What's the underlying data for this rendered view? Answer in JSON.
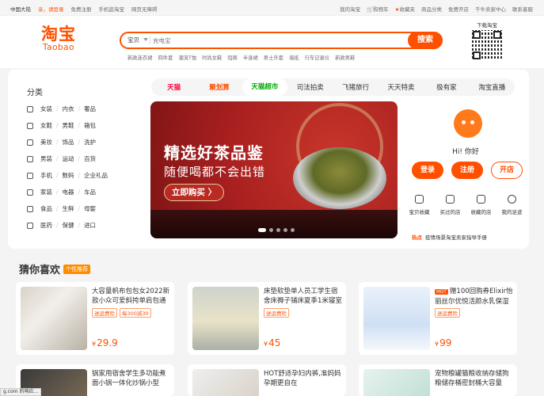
{
  "topbar": {
    "region": "中国大陆",
    "greeting": "亲，请登录",
    "register": "免费注册",
    "mobile": "手机逛淘宝",
    "accessible": "网页无障碍",
    "right": [
      "我的淘宝",
      "购物车",
      "收藏夹",
      "商品分类",
      "免费开店",
      "千牛卖家中心",
      "联系客服"
    ]
  },
  "logo": {
    "cn": "淘宝",
    "en": "Taobao"
  },
  "search": {
    "category": "宝贝",
    "placeholder": "充电宝",
    "button": "搜索"
  },
  "hotwords": [
    "新款连衣裙",
    "四件套",
    "潮流T恤",
    "时尚女鞋",
    "短裤",
    "半身裙",
    "男士外套",
    "墙纸",
    "行车记录仪",
    "新款男鞋"
  ],
  "qr": {
    "label": "下载淘宝"
  },
  "categories": {
    "title": "分类",
    "rows": [
      [
        "女装",
        "内衣",
        "奢品"
      ],
      [
        "女鞋",
        "男鞋",
        "箱包"
      ],
      [
        "美妆",
        "饰品",
        "洗护"
      ],
      [
        "男装",
        "运动",
        "百货"
      ],
      [
        "手机",
        "数码",
        "企业礼品"
      ],
      [
        "家装",
        "电器",
        "车品"
      ],
      [
        "食品",
        "生鲜",
        "母婴"
      ],
      [
        "医药",
        "保健",
        "进口"
      ]
    ]
  },
  "nav": [
    "天猫",
    "聚划算",
    "天猫超市",
    "司法拍卖",
    "飞猪旅行",
    "天天特卖",
    "极有家",
    "淘宝直播"
  ],
  "banner": {
    "line1": "精选好茶品鉴",
    "line2": "随便喝都不会出错",
    "cta": "立即购买 〉"
  },
  "user": {
    "hi": "Hi! 你好",
    "login": "登录",
    "register": "注册",
    "open": "开店",
    "icons": [
      "宝贝收藏",
      "买过的店",
      "收藏的店",
      "我的足迹"
    ],
    "notice_tag": "热点",
    "notice": "疫情场景淘宝卖家指导手册"
  },
  "feed": {
    "title": "猜你喜欢",
    "tag": "个性推荐",
    "cards": [
      {
        "title": "大容量帆布包包女2022新款小众可爱斜挎单肩包通",
        "tags": [
          "送运费险",
          "每300减30"
        ],
        "price": "29.9",
        "hot": ""
      },
      {
        "title": "床垫软垫单人员工学生宿舍床褥子铺床夏季1米寝室",
        "tags": [
          "送运费险"
        ],
        "price": "45",
        "hot": ""
      },
      {
        "title": "赠100回购券Elixir怡丽丝尔优悦活颜水乳保湿",
        "tags": [
          "送运费险"
        ],
        "price": "99",
        "hot": "HOT"
      }
    ],
    "cards2": [
      {
        "title": "锅家用宿舍学生多功能煮面小锅一体化炒锅小型",
        "hot": ""
      },
      {
        "title": "舒适孕妇内裤,准妈妈孕期更自在",
        "hot": "HOT"
      },
      {
        "title": "宠物粮罐猫粮收纳存储狗粮储存桶密封桶大容量",
        "hot": ""
      }
    ],
    "currency": "¥"
  },
  "statusbar": "g.com 的响应..."
}
